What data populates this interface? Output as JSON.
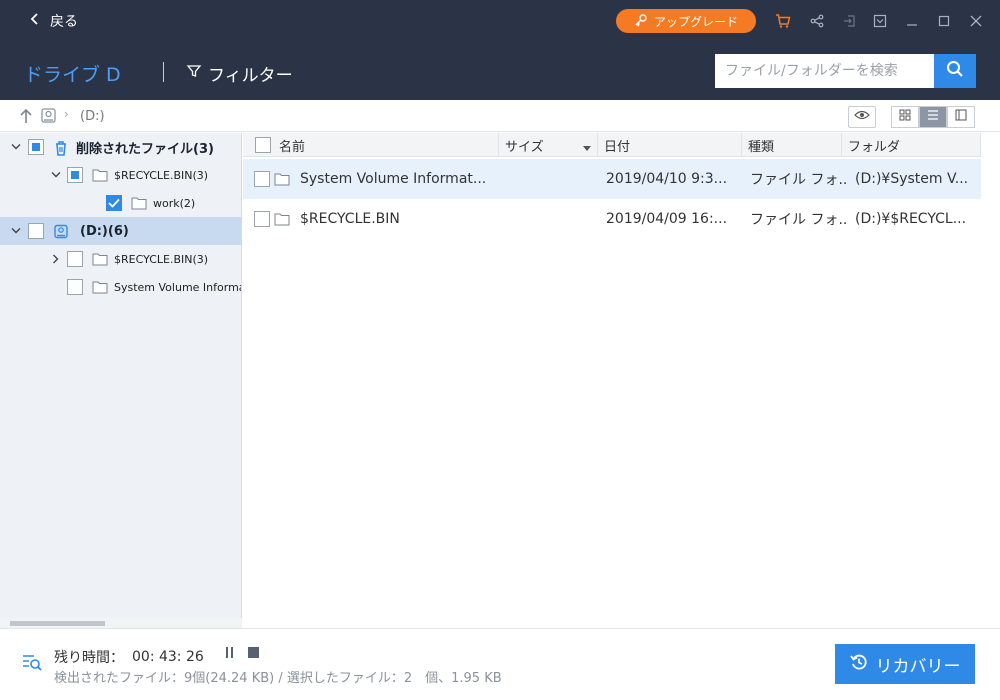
{
  "titlebar": {
    "back_label": "戻る",
    "upgrade_label": "アップグレード",
    "icons": [
      "cart-icon",
      "share-icon",
      "login-icon",
      "dropdown-menu-icon",
      "minimize-icon",
      "maximize-icon",
      "close-icon"
    ]
  },
  "header": {
    "drive_title": "ドライブ D",
    "filter_label": "フィルター",
    "search_placeholder": "ファイル/フォルダーを検索"
  },
  "pathbar": {
    "path": "(D:)"
  },
  "tree": {
    "items": [
      {
        "label": "削除されたファイル(3)"
      },
      {
        "label": "$RECYCLE.BIN(3)"
      },
      {
        "label": "work(2)"
      },
      {
        "label": "(D:)(6)"
      },
      {
        "label": "$RECYCLE.BIN(3)"
      },
      {
        "label": "System Volume Information"
      }
    ]
  },
  "list": {
    "columns": {
      "name": "名前",
      "size": "サイズ",
      "date": "日付",
      "type": "種類",
      "folder": "フォルダ"
    },
    "rows": [
      {
        "name": "System Volume Informat...",
        "size": "",
        "date": "2019/04/10 9:3...",
        "type": "ファイル フォ...",
        "folder": "(D:)¥System V..."
      },
      {
        "name": "$RECYCLE.BIN",
        "size": "",
        "date": "2019/04/09 16:...",
        "type": "ファイル フォ...",
        "folder": "(D:)¥$RECYCL..."
      }
    ]
  },
  "footer": {
    "remaining_label": "残り時間：",
    "remaining_time": "00: 43: 26",
    "stats": "検出されたファイル：9個(24.24 KB) / 選択したファイル：2　個、1.95 KB",
    "recover_label": "リカバリー"
  },
  "colors": {
    "titlebar_bg": "#2b3446",
    "accent_blue": "#2e8ae6",
    "upgrade_orange": "#f47a23",
    "tree_bg": "#eef1f6",
    "tree_selected": "#c8daf0",
    "row_highlight": "#e6f1fb"
  }
}
